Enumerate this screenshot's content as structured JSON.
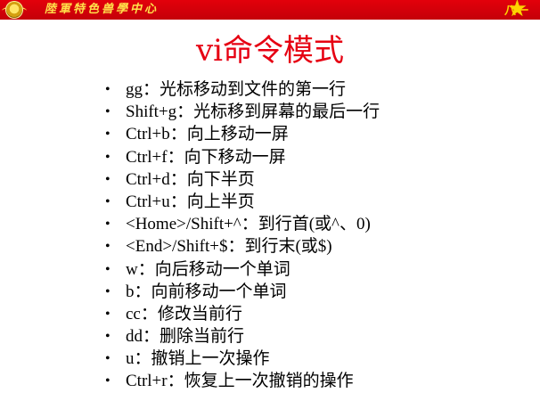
{
  "header": {
    "banner_title": "陸軍特色兽學中心",
    "badge_text": "八一",
    "star_glyph": "★",
    "accent_color": "#e3000b"
  },
  "slide": {
    "title": "vi命令模式",
    "commands": [
      "gg：光标移动到文件的第一行",
      "Shift+g：光标移到屏幕的最后一行",
      "Ctrl+b：向上移动一屏",
      "Ctrl+f：向下移动一屏",
      "Ctrl+d：向下半页",
      "Ctrl+u：向上半页",
      "<Home>/Shift+^：到行首(或^、0)",
      "<End>/Shift+$：到行末(或$)",
      "w：向后移动一个单词",
      "b：向前移动一个单词",
      "cc：修改当前行",
      "dd：删除当前行",
      "u：撤销上一次操作",
      "Ctrl+r：恢复上一次撤销的操作"
    ]
  }
}
